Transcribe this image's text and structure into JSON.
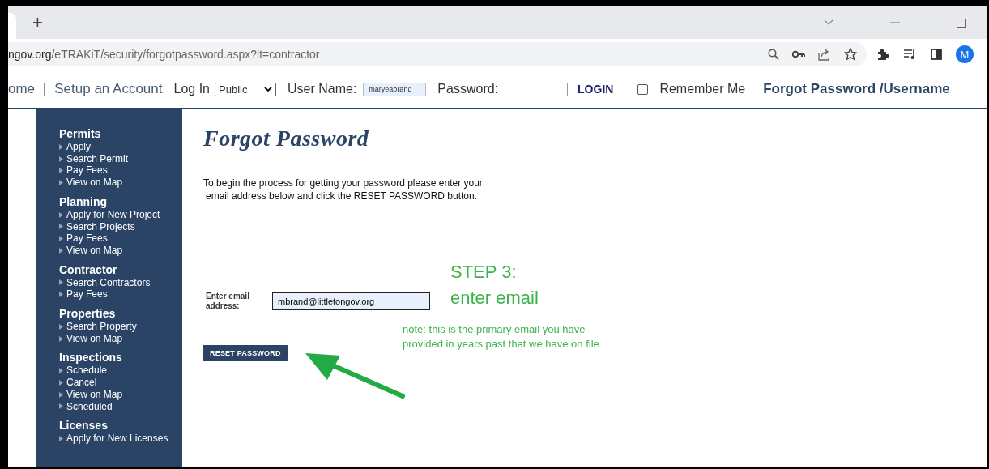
{
  "browser": {
    "new_tab": "+",
    "avatar": "M",
    "url_host": "ngov.org",
    "url_path": "/eTRAKiT/security/forgotpassword.aspx?lt=contractor"
  },
  "nav": {
    "home": "ome",
    "separator": "|",
    "setup": "Setup an Account",
    "login_label": "Log In",
    "login_type": "Public",
    "username_label": "User Name:",
    "username": "maryeabrand",
    "password_label": "Password:",
    "login_button": "LOGIN",
    "remember": {
      "label": "Remember Me",
      "checked": false
    },
    "forgot": "Forgot Password /Username"
  },
  "sidebar": [
    {
      "heading": "Permits",
      "items": [
        "Apply",
        "Search Permit",
        "Pay Fees",
        "View on Map"
      ]
    },
    {
      "heading": "Planning",
      "items": [
        "Apply for New Project",
        "Search Projects",
        "Pay Fees",
        "View on Map"
      ]
    },
    {
      "heading": "Contractor",
      "items": [
        "Search Contractors",
        "Pay Fees"
      ]
    },
    {
      "heading": "Properties",
      "items": [
        "Search Property",
        "View on Map"
      ]
    },
    {
      "heading": "Inspections",
      "items": [
        "Schedule",
        "Cancel",
        "View on Map",
        "Scheduled"
      ]
    },
    {
      "heading": "Licenses",
      "items": [
        "Apply for New Licenses"
      ]
    }
  ],
  "main": {
    "title": "Forgot Password",
    "instructions": [
      "To begin the process for getting your password please enter your",
      "email address below and click the RESET PASSWORD button."
    ],
    "email_label": "Enter email address:",
    "email": "mbrand@littletongov.org",
    "reset_button": "RESET PASSWORD"
  },
  "annotation": {
    "step": "STEP 3:",
    "step_detail": "enter email",
    "note": [
      "note: this is the primary email you have",
      "provided in years past that we have on file"
    ]
  }
}
